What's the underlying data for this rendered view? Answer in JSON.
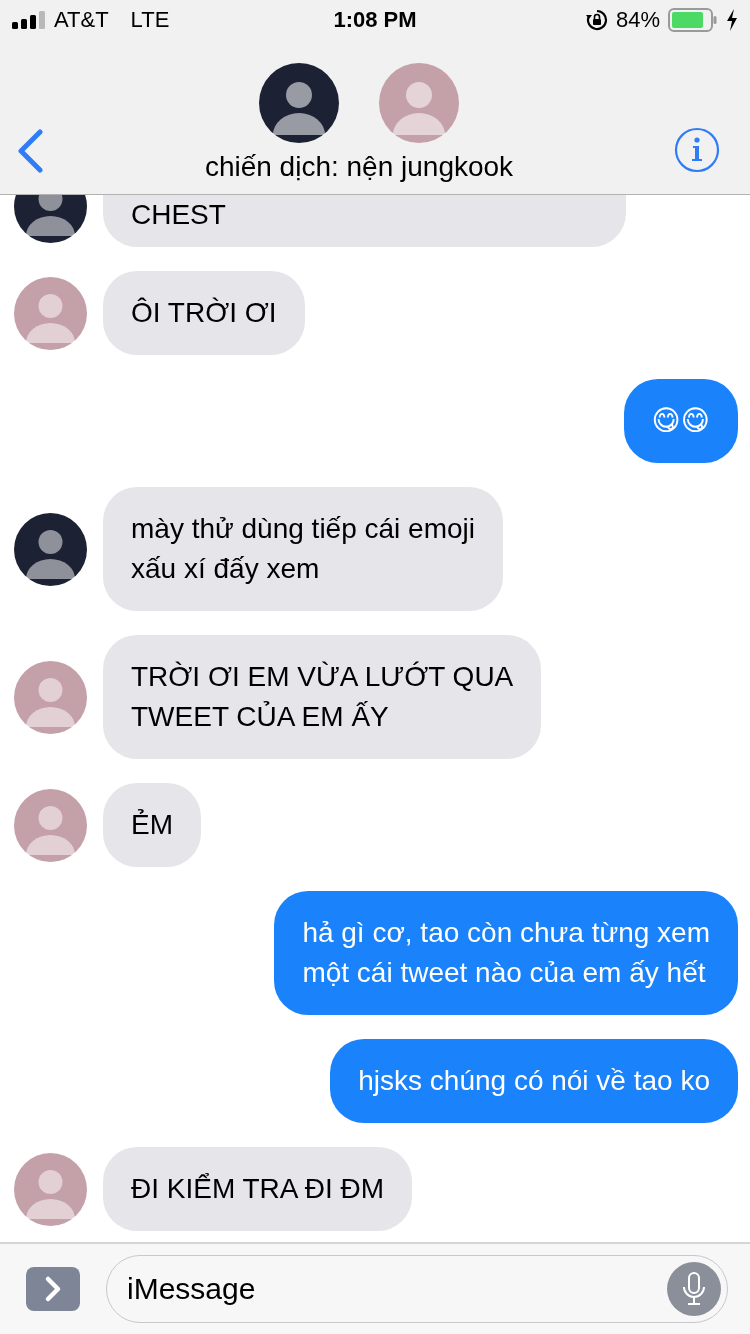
{
  "status_bar": {
    "carrier": "AT&T",
    "network": "LTE",
    "time": "1:08 PM",
    "battery": "84%"
  },
  "header": {
    "participants": [
      {
        "color": "#1c2233"
      },
      {
        "color": "#c4a0a8"
      }
    ],
    "title": "chiến dịch: nện jungkook"
  },
  "messages": [
    {
      "kind": "received",
      "color": "#1c2233",
      "lines": [
        "CHEST"
      ],
      "cut": true
    },
    {
      "kind": "received",
      "color": "#c4a0a8",
      "lines": [
        "ÔI TRỜI ƠI"
      ],
      "cut": false
    },
    {
      "kind": "sent",
      "lines": [
        "😋😋"
      ],
      "cut": false
    },
    {
      "kind": "received",
      "color": "#1c2233",
      "lines": [
        "mày thử dùng tiếp cái emoji",
        "xấu xí đấy xem"
      ],
      "cut": false
    },
    {
      "kind": "received",
      "color": "#c4a0a8",
      "lines": [
        "TRỜI ƠI EM VỪA LƯỚT QUA",
        "TWEET CỦA EM ẤY"
      ],
      "cut": false
    },
    {
      "kind": "received",
      "color": "#c4a0a8",
      "lines": [
        "ẺM"
      ],
      "cut": false
    },
    {
      "kind": "sent",
      "lines": [
        "hả gì cơ, tao còn chưa từng xem",
        "một cái tweet nào của em ấy hết"
      ],
      "cut": false
    },
    {
      "kind": "sent",
      "lines": [
        "hjsks chúng có nói về tao ko"
      ],
      "cut": false
    },
    {
      "kind": "received",
      "color": "#c4a0a8",
      "lines": [
        "ĐI KIỂM TRA ĐI ĐM"
      ],
      "cut": false
    }
  ],
  "composer": {
    "placeholder": "iMessage"
  }
}
